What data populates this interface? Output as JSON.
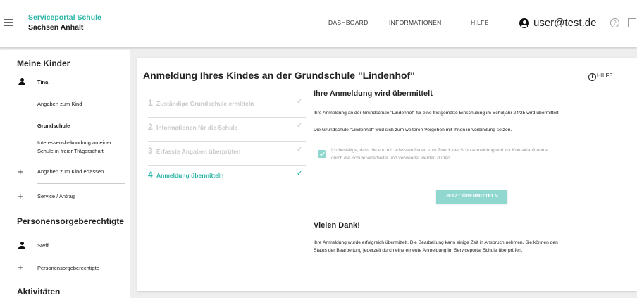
{
  "header": {
    "brand_line1": "Serviceportal Schule",
    "brand_line2": "Sachsen Anhalt",
    "nav": [
      "DASHBOARD",
      "INFORMATIONEN",
      "HILFE"
    ],
    "user": "user@test.de",
    "help_icon_glyph": "?"
  },
  "sidebar": {
    "section1": "Meine Kinder",
    "child_name": "Tina",
    "child_items": [
      "Angaben zum Kind",
      "Grundschule",
      "Interessensbekundung an einer",
      "Schule in freier Trägerschaft"
    ],
    "add_child_data": "Angaben zum Kind erfassen",
    "service": "Service / Antrag",
    "section2": "Personensorgeberechtigte",
    "guardian_name": "Steffi",
    "guardians_link": "Personensorgeberechtigte",
    "section3": "Aktivitäten"
  },
  "main": {
    "title": "Anmeldung Ihres Kindes an der Grundschule \"Lindenhof\"",
    "help_label": "HILFE",
    "info_glyph": "i",
    "steps": [
      {
        "num": "1",
        "label": "Zuständige Grundschule ermitteln",
        "check": "✓"
      },
      {
        "num": "2",
        "label": "Informationen für die Schule",
        "check": "✓"
      },
      {
        "num": "3",
        "label": "Erfasste Angaben überprüfen",
        "check": "✓"
      },
      {
        "num": "4",
        "label": "Anmeldung übermitteln",
        "check": "✓"
      }
    ],
    "heading": "Ihre Anmeldung wird übermittelt",
    "para1": "Ihre Anmeldung an der Grundschule \"Lindenhof\" für eine fristgemäße Einschulung im Schuljahr 24/25 wird übermittelt.",
    "para2": "Die Grundschule \"Lindenhof\" wird sich zum weiteren Vorgehen mit Ihnen in Verbindung setzen.",
    "confirm_line1": "Ich bestätige, dass die von mir erfassten Daten zum Zweck der Schulanmeldung und zur Kontaktaufnahme",
    "confirm_line2": "durch die Schule verarbeitet und verwendet werden dürfen.",
    "submit_label": "JETZT ÜBERMITTELN",
    "thanks_heading": "Vielen Dank!",
    "thanks_line1": "Ihre Anmeldung wurde erfolgreich übermittelt. Die Bearbeitung kann einige Zeit in Anspruch nehmen. Sie können den",
    "thanks_line2": "Status der Bearbeitung jederzeit durch eine erneute Anmeldung im Serviceportal Schule überprüfen."
  },
  "colors": {
    "accent": "#2bb5a6",
    "accent_light": "#8fd7cf"
  }
}
